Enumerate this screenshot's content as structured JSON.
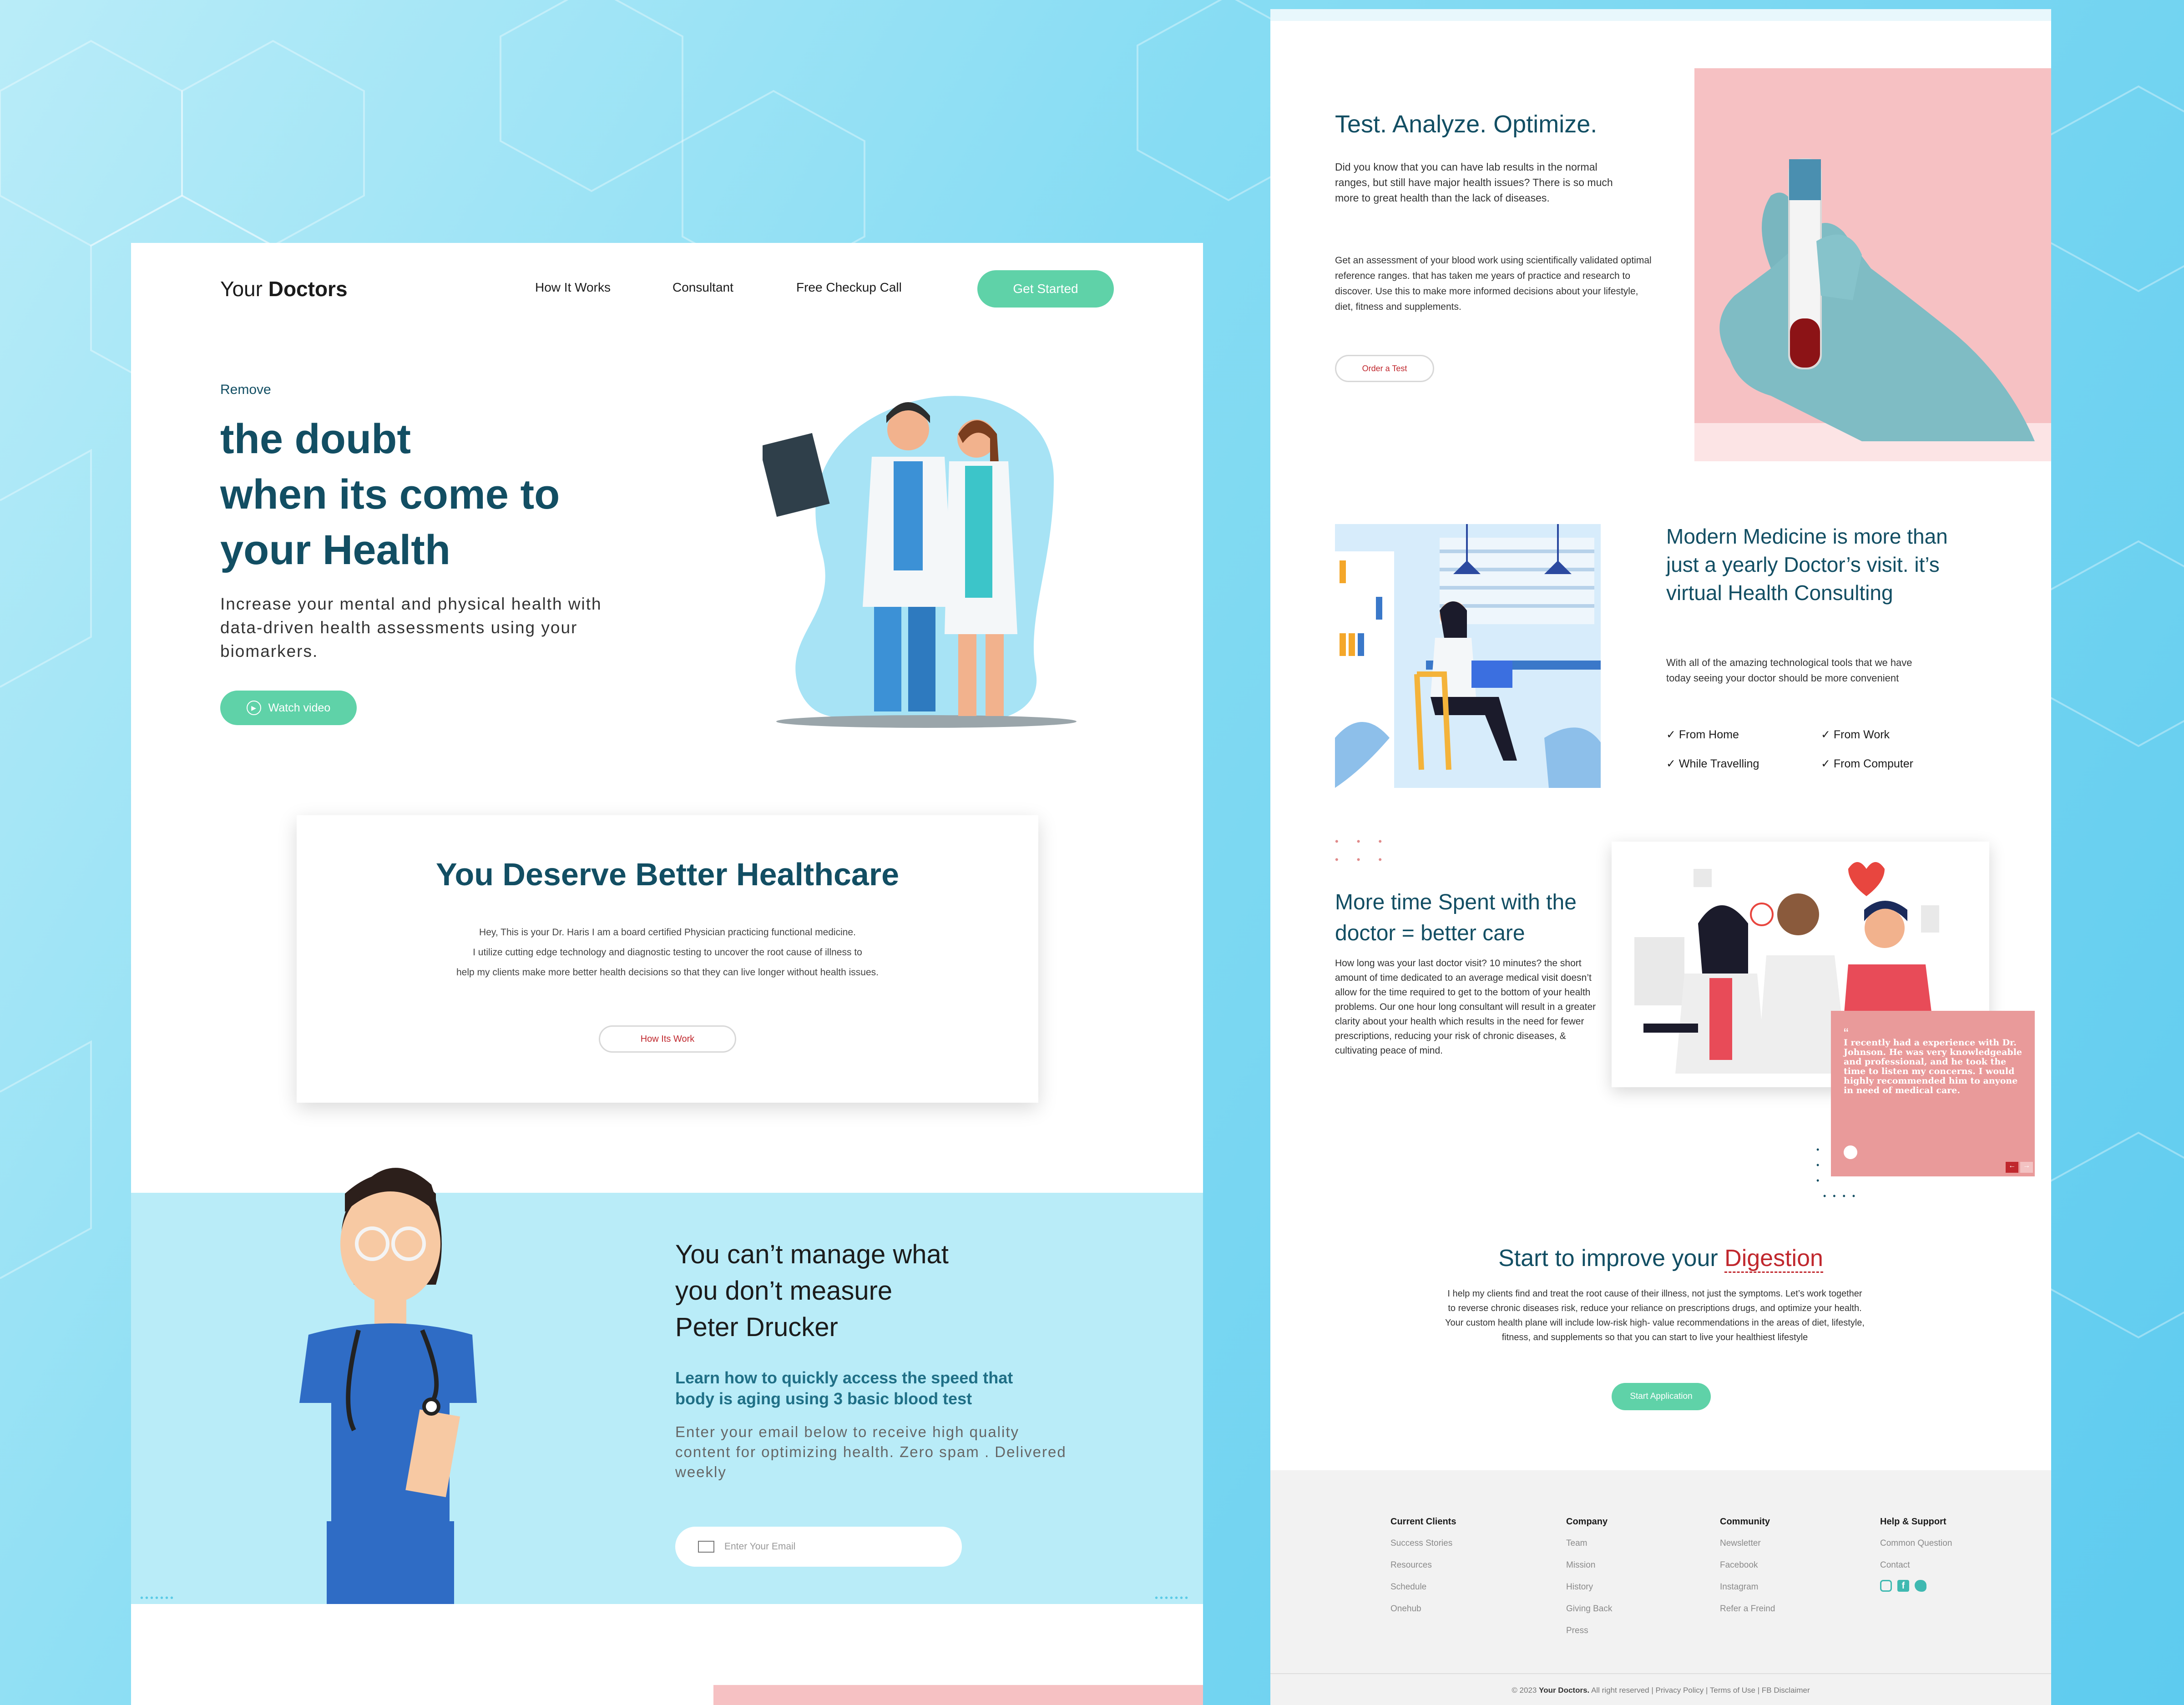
{
  "colors": {
    "teal": "#124e63",
    "green": "#5fd2a8",
    "pink": "#f6c1c3",
    "red": "#c0272d",
    "lightblue": "#b9ecf8"
  },
  "header": {
    "brand_light": "Your",
    "brand_bold": "Doctors",
    "nav": [
      "How It Works",
      "Consultant",
      "Free Checkup Call"
    ],
    "cta": "Get Started"
  },
  "hero": {
    "eyebrow": "Remove",
    "title_lines": [
      "the doubt",
      "when its come to",
      "your Health"
    ],
    "subtitle": "Increase your mental and physical health with data-driven health assessments using your biomarkers.",
    "video_label": "Watch video"
  },
  "better": {
    "title": "You Deserve Better Healthcare",
    "body_lines": [
      "Hey, This is your Dr. Haris I am a board certified Physician practicing functional medicine.",
      "I utilize cutting edge technology and diagnostic testing to uncover the root cause of illness to",
      "help my clients make more better health decisions so that they can live longer without health issues."
    ],
    "button": "How Its Work"
  },
  "measure": {
    "title_lines": [
      "You can’t manage what",
      "you don’t measure",
      "Peter Drucker"
    ],
    "highlight": "Learn how to quickly access the speed that body is aging using 3 basic blood test",
    "body": "Enter your email below to receive high quality content for optimizing health. Zero spam . Delivered weekly",
    "email_placeholder": "Enter Your Email"
  },
  "test": {
    "title": "Test. Analyze. Optimize.",
    "p1": "Did you know that you can have lab results in the normal ranges, but still have major health issues? There is so much more to great health than the lack of diseases.",
    "p2": "Get an assessment of your blood work using scientifically validated optimal reference ranges. that has taken me years of practice and research to discover. Use this to make more informed decisions about your lifestyle, diet, fitness and supplements.",
    "button": "Order a Test"
  },
  "modern": {
    "title": "Modern Medicine is more than just a yearly Doctor’s visit. it’s virtual Health Consulting",
    "body": "With all of the amazing technological tools that we have today seeing your doctor should be more convenient",
    "checks": [
      "From Home",
      "From Work",
      "While Travelling",
      "From Computer"
    ]
  },
  "time": {
    "title": "More time Spent with the doctor = better care",
    "body": "How long was your last doctor visit? 10 minutes? the short amount of time dedicated to an average medical visit doesn’t allow for the time required to get to the bottom of your health problems. Our one hour long consultant will result in a greater clarity about your health which results in the need for fewer prescriptions, reducing your risk of chronic diseases, & cultivating peace of mind.",
    "quote": "I recently had a experience with Dr. Johnson. He was very knowledgeable and professional, and he took the time to listen my concerns. I would highly recommended him to anyone in need of medical care."
  },
  "digestion": {
    "title_prefix": "Start to improve your",
    "title_accent": "Digestion",
    "body": "I help my clients find and treat the root cause of their illness, not just the symptoms. Let’s work together to reverse chronic diseases risk, reduce your reliance on prescriptions drugs, and optimize your health. Your custom health plane will include low-risk high- value recommendations in the areas of diet, lifestyle, fitness, and supplements so that you can start to live your healthiest lifestyle",
    "button": "Start Application"
  },
  "footer": {
    "columns": [
      {
        "title": "Current Clients",
        "items": [
          "Success Stories",
          "Resources",
          "Schedule",
          "Onehub"
        ]
      },
      {
        "title": "Company",
        "items": [
          "Team",
          "Mission",
          "History",
          "Giving Back",
          "Press"
        ]
      },
      {
        "title": "Community",
        "items": [
          "Newsletter",
          "Facebook",
          "Instagram",
          "Refer a Freind"
        ]
      },
      {
        "title": "Help & Support",
        "items": [
          "Common Question",
          "Contact"
        ]
      }
    ],
    "copyright_prefix": "© 2023",
    "copyright_brand": "Your Doctors.",
    "copyright_rest": "All right reserved",
    "links": [
      "Privacy Policy",
      "Terms of Use",
      "FB Disclaimer"
    ]
  }
}
